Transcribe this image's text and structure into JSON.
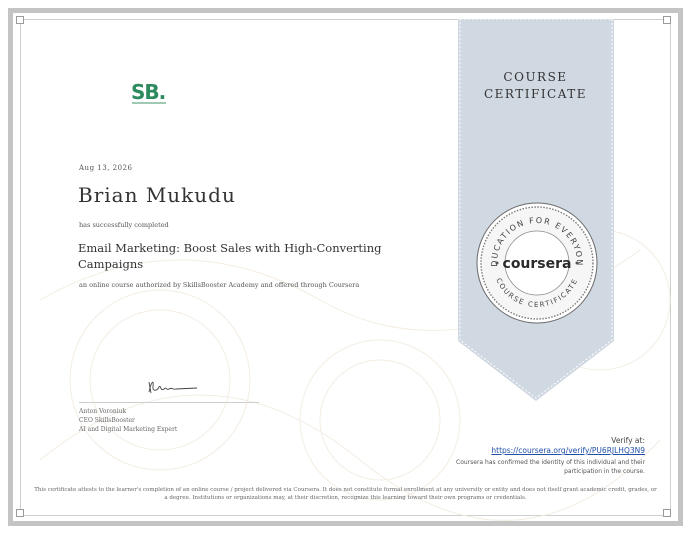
{
  "certificate": {
    "logo_text": "SB.",
    "date": "Aug 13, 2026",
    "recipient_name": "Brian Mukudu",
    "completed_text": "has successfully completed",
    "course_title": "Email Marketing: Boost Sales with High-Converting Campaigns",
    "offered_text": "an online course authorized by SkillsBooster Academy and offered through Coursera",
    "signer_name": "Anton Voroniuk",
    "signer_title": "CEO SkillsBooster",
    "signer_role": "AI and Digital Marketing Expert",
    "ribbon_line1": "COURSE",
    "ribbon_line2": "CERTIFICATE",
    "seal_top_text": "EDUCATION FOR EVERYONE",
    "seal_bottom_text": "COURSE CERTIFICATE",
    "seal_brand": "coursera",
    "verify_label": "Verify at:",
    "verify_url": "https://coursera.org/verify/PU6RJLHQ3N9",
    "verify_note_line1": "Coursera has confirmed the identity of this individual and their",
    "verify_note_line2": "participation in the course.",
    "disclaimer_line1": "This certificate attests to the learner's completion of an online course / project delivered via Coursera. It does not constitute formal enrollment at any university or entity and does not itself grant academic credit, grades, or",
    "disclaimer_line2": "a degree. Institutions or organizations may, at their discretion, recognize this learning toward their own programs or credentials."
  },
  "colors": {
    "logo_green": "#2d8a5f",
    "ribbon": "#d0d8e2",
    "link": "#1f4fa8"
  }
}
